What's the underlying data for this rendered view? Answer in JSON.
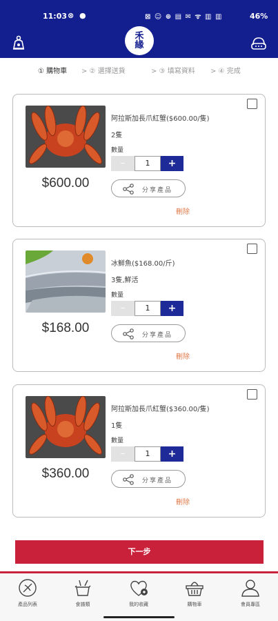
{
  "status_bar": {
    "time": "11:03",
    "left_icons": "⊗ ●",
    "right_icons": "⊠ ☺ ⊕ ▤ ✉ ᯤ ▥ ▥",
    "battery": "46%"
  },
  "header": {
    "logo_text": "禾 緣"
  },
  "steps": [
    {
      "label": "① 購物車"
    },
    {
      "label": "> ② 選擇送貨"
    },
    {
      "label": "> ③ 填寫資料"
    },
    {
      "label": "> ④ 完成"
    }
  ],
  "cart": {
    "quantity_label": "數量",
    "share_label": "分享產品",
    "delete_label": "刪除",
    "items": [
      {
        "name": "阿拉斯加長爪紅蟹($600.00/隻)",
        "spec": "2隻",
        "price": "$600.00",
        "quantity": "1",
        "image": "red-king-crab"
      },
      {
        "name": "冰鮮魚($168.00/斤)",
        "spec": "3隻,鮮活",
        "price": "$168.00",
        "quantity": "1",
        "image": "fresh-fish"
      },
      {
        "name": "阿拉斯加長爪紅蟹($360.00/隻)",
        "spec": "1隻",
        "price": "$360.00",
        "quantity": "1",
        "image": "red-king-crab"
      }
    ]
  },
  "next_button": {
    "label": "下一步"
  },
  "tab_bar": [
    {
      "label": "產品列表",
      "icon": "product-list-icon"
    },
    {
      "label": "食譜類",
      "icon": "recipe-icon"
    },
    {
      "label": "我的收藏",
      "icon": "favorites-icon"
    },
    {
      "label": "購物車",
      "icon": "cart-icon"
    },
    {
      "label": "會員專區",
      "icon": "member-icon"
    }
  ],
  "colors": {
    "brand_blue": "#131f8f",
    "accent_red": "#c9213a",
    "delete_orange": "#e07a4a"
  }
}
